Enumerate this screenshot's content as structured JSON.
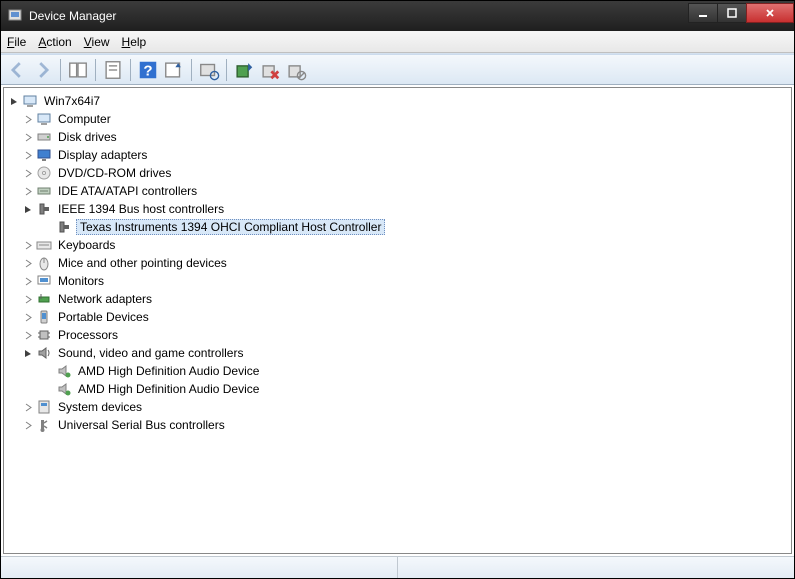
{
  "window": {
    "title": "Device Manager"
  },
  "menu": {
    "file": "File",
    "action": "Action",
    "view": "View",
    "help": "Help"
  },
  "tree": {
    "root": {
      "label": "Win7x64i7",
      "expanded": true
    },
    "nodes": [
      {
        "label": "Computer",
        "expanded": false,
        "children": []
      },
      {
        "label": "Disk drives",
        "expanded": false,
        "children": []
      },
      {
        "label": "Display adapters",
        "expanded": false,
        "children": []
      },
      {
        "label": "DVD/CD-ROM drives",
        "expanded": false,
        "children": []
      },
      {
        "label": "IDE ATA/ATAPI controllers",
        "expanded": false,
        "children": []
      },
      {
        "label": "IEEE 1394 Bus host controllers",
        "expanded": true,
        "children": [
          {
            "label": "Texas Instruments 1394 OHCI Compliant Host Controller",
            "selected": true
          }
        ]
      },
      {
        "label": "Keyboards",
        "expanded": false,
        "children": []
      },
      {
        "label": "Mice and other pointing devices",
        "expanded": false,
        "children": []
      },
      {
        "label": "Monitors",
        "expanded": false,
        "children": []
      },
      {
        "label": "Network adapters",
        "expanded": false,
        "children": []
      },
      {
        "label": "Portable Devices",
        "expanded": false,
        "children": []
      },
      {
        "label": "Processors",
        "expanded": false,
        "children": []
      },
      {
        "label": "Sound, video and game controllers",
        "expanded": true,
        "children": [
          {
            "label": "AMD High Definition Audio Device"
          },
          {
            "label": "AMD High Definition Audio Device"
          }
        ]
      },
      {
        "label": "System devices",
        "expanded": false,
        "children": []
      },
      {
        "label": "Universal Serial Bus controllers",
        "expanded": false,
        "children": []
      }
    ]
  }
}
